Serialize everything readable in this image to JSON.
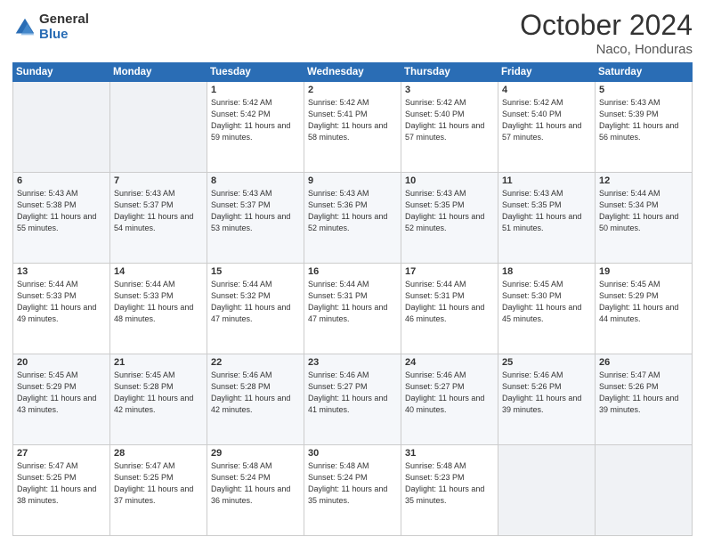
{
  "logo": {
    "general": "General",
    "blue": "Blue"
  },
  "header": {
    "month": "October 2024",
    "location": "Naco, Honduras"
  },
  "weekdays": [
    "Sunday",
    "Monday",
    "Tuesday",
    "Wednesday",
    "Thursday",
    "Friday",
    "Saturday"
  ],
  "weeks": [
    [
      {
        "day": "",
        "sunrise": "",
        "sunset": "",
        "daylight": ""
      },
      {
        "day": "",
        "sunrise": "",
        "sunset": "",
        "daylight": ""
      },
      {
        "day": "1",
        "sunrise": "Sunrise: 5:42 AM",
        "sunset": "Sunset: 5:42 PM",
        "daylight": "Daylight: 11 hours and 59 minutes."
      },
      {
        "day": "2",
        "sunrise": "Sunrise: 5:42 AM",
        "sunset": "Sunset: 5:41 PM",
        "daylight": "Daylight: 11 hours and 58 minutes."
      },
      {
        "day": "3",
        "sunrise": "Sunrise: 5:42 AM",
        "sunset": "Sunset: 5:40 PM",
        "daylight": "Daylight: 11 hours and 57 minutes."
      },
      {
        "day": "4",
        "sunrise": "Sunrise: 5:42 AM",
        "sunset": "Sunset: 5:40 PM",
        "daylight": "Daylight: 11 hours and 57 minutes."
      },
      {
        "day": "5",
        "sunrise": "Sunrise: 5:43 AM",
        "sunset": "Sunset: 5:39 PM",
        "daylight": "Daylight: 11 hours and 56 minutes."
      }
    ],
    [
      {
        "day": "6",
        "sunrise": "Sunrise: 5:43 AM",
        "sunset": "Sunset: 5:38 PM",
        "daylight": "Daylight: 11 hours and 55 minutes."
      },
      {
        "day": "7",
        "sunrise": "Sunrise: 5:43 AM",
        "sunset": "Sunset: 5:37 PM",
        "daylight": "Daylight: 11 hours and 54 minutes."
      },
      {
        "day": "8",
        "sunrise": "Sunrise: 5:43 AM",
        "sunset": "Sunset: 5:37 PM",
        "daylight": "Daylight: 11 hours and 53 minutes."
      },
      {
        "day": "9",
        "sunrise": "Sunrise: 5:43 AM",
        "sunset": "Sunset: 5:36 PM",
        "daylight": "Daylight: 11 hours and 52 minutes."
      },
      {
        "day": "10",
        "sunrise": "Sunrise: 5:43 AM",
        "sunset": "Sunset: 5:35 PM",
        "daylight": "Daylight: 11 hours and 52 minutes."
      },
      {
        "day": "11",
        "sunrise": "Sunrise: 5:43 AM",
        "sunset": "Sunset: 5:35 PM",
        "daylight": "Daylight: 11 hours and 51 minutes."
      },
      {
        "day": "12",
        "sunrise": "Sunrise: 5:44 AM",
        "sunset": "Sunset: 5:34 PM",
        "daylight": "Daylight: 11 hours and 50 minutes."
      }
    ],
    [
      {
        "day": "13",
        "sunrise": "Sunrise: 5:44 AM",
        "sunset": "Sunset: 5:33 PM",
        "daylight": "Daylight: 11 hours and 49 minutes."
      },
      {
        "day": "14",
        "sunrise": "Sunrise: 5:44 AM",
        "sunset": "Sunset: 5:33 PM",
        "daylight": "Daylight: 11 hours and 48 minutes."
      },
      {
        "day": "15",
        "sunrise": "Sunrise: 5:44 AM",
        "sunset": "Sunset: 5:32 PM",
        "daylight": "Daylight: 11 hours and 47 minutes."
      },
      {
        "day": "16",
        "sunrise": "Sunrise: 5:44 AM",
        "sunset": "Sunset: 5:31 PM",
        "daylight": "Daylight: 11 hours and 47 minutes."
      },
      {
        "day": "17",
        "sunrise": "Sunrise: 5:44 AM",
        "sunset": "Sunset: 5:31 PM",
        "daylight": "Daylight: 11 hours and 46 minutes."
      },
      {
        "day": "18",
        "sunrise": "Sunrise: 5:45 AM",
        "sunset": "Sunset: 5:30 PM",
        "daylight": "Daylight: 11 hours and 45 minutes."
      },
      {
        "day": "19",
        "sunrise": "Sunrise: 5:45 AM",
        "sunset": "Sunset: 5:29 PM",
        "daylight": "Daylight: 11 hours and 44 minutes."
      }
    ],
    [
      {
        "day": "20",
        "sunrise": "Sunrise: 5:45 AM",
        "sunset": "Sunset: 5:29 PM",
        "daylight": "Daylight: 11 hours and 43 minutes."
      },
      {
        "day": "21",
        "sunrise": "Sunrise: 5:45 AM",
        "sunset": "Sunset: 5:28 PM",
        "daylight": "Daylight: 11 hours and 42 minutes."
      },
      {
        "day": "22",
        "sunrise": "Sunrise: 5:46 AM",
        "sunset": "Sunset: 5:28 PM",
        "daylight": "Daylight: 11 hours and 42 minutes."
      },
      {
        "day": "23",
        "sunrise": "Sunrise: 5:46 AM",
        "sunset": "Sunset: 5:27 PM",
        "daylight": "Daylight: 11 hours and 41 minutes."
      },
      {
        "day": "24",
        "sunrise": "Sunrise: 5:46 AM",
        "sunset": "Sunset: 5:27 PM",
        "daylight": "Daylight: 11 hours and 40 minutes."
      },
      {
        "day": "25",
        "sunrise": "Sunrise: 5:46 AM",
        "sunset": "Sunset: 5:26 PM",
        "daylight": "Daylight: 11 hours and 39 minutes."
      },
      {
        "day": "26",
        "sunrise": "Sunrise: 5:47 AM",
        "sunset": "Sunset: 5:26 PM",
        "daylight": "Daylight: 11 hours and 39 minutes."
      }
    ],
    [
      {
        "day": "27",
        "sunrise": "Sunrise: 5:47 AM",
        "sunset": "Sunset: 5:25 PM",
        "daylight": "Daylight: 11 hours and 38 minutes."
      },
      {
        "day": "28",
        "sunrise": "Sunrise: 5:47 AM",
        "sunset": "Sunset: 5:25 PM",
        "daylight": "Daylight: 11 hours and 37 minutes."
      },
      {
        "day": "29",
        "sunrise": "Sunrise: 5:48 AM",
        "sunset": "Sunset: 5:24 PM",
        "daylight": "Daylight: 11 hours and 36 minutes."
      },
      {
        "day": "30",
        "sunrise": "Sunrise: 5:48 AM",
        "sunset": "Sunset: 5:24 PM",
        "daylight": "Daylight: 11 hours and 35 minutes."
      },
      {
        "day": "31",
        "sunrise": "Sunrise: 5:48 AM",
        "sunset": "Sunset: 5:23 PM",
        "daylight": "Daylight: 11 hours and 35 minutes."
      },
      {
        "day": "",
        "sunrise": "",
        "sunset": "",
        "daylight": ""
      },
      {
        "day": "",
        "sunrise": "",
        "sunset": "",
        "daylight": ""
      }
    ]
  ]
}
